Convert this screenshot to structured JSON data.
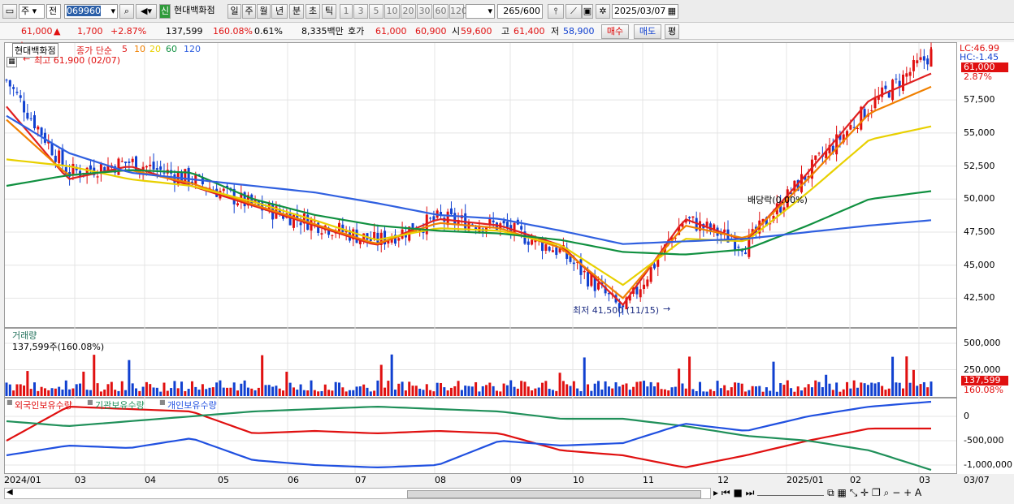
{
  "toolbar": {
    "period_type": "주",
    "prev_label": "전",
    "code": "069960",
    "new_badge": "신",
    "name": "현대백화점",
    "periods": [
      {
        "label": "일",
        "selected": true
      },
      {
        "label": "주",
        "selected": false
      },
      {
        "label": "월",
        "selected": false
      },
      {
        "label": "년",
        "selected": false
      },
      {
        "label": "분",
        "selected": false
      },
      {
        "label": "초",
        "selected": false
      },
      {
        "label": "틱",
        "selected": false
      }
    ],
    "intervals": [
      "1",
      "3",
      "5",
      "10",
      "20",
      "30",
      "60",
      "120"
    ],
    "count": "265",
    "count_total": "/600",
    "date": "2025/03/07"
  },
  "quote": {
    "price": "61,000",
    "change": "1,700",
    "change_pct": "+2.87%",
    "volume": "137,599",
    "volume_ratio": "160.08%",
    "turnover": "0.61%",
    "amount": "8,335백만",
    "ask_label": "호가",
    "ask": "61,000",
    "bid": "60,900",
    "open_label": "시",
    "open": "59,600",
    "high_label": "고",
    "high": "61,400",
    "low_label": "저",
    "low": "58,900",
    "buy_label": "매수",
    "sell_label": "매도",
    "eval_label": "평"
  },
  "price_panel": {
    "title": "현대백화점",
    "ma_label": "종가 단순",
    "ma_periods": [
      {
        "label": "5",
        "color": "#e02020"
      },
      {
        "label": "10",
        "color": "#f08000"
      },
      {
        "label": "20",
        "color": "#e8d000"
      },
      {
        "label": "60",
        "color": "#109040"
      },
      {
        "label": "120",
        "color": "#3060e0"
      }
    ],
    "high_note": "최고 61,900 (02/07)",
    "low_note": "최저 41,500 (11/15)",
    "dividend_note": "배당락(0.00%)",
    "lc": "LC:46.99",
    "hc": "HC:-1.45",
    "last_price": "61,000",
    "last_pct": "2.87%"
  },
  "volume_panel": {
    "title": "거래량",
    "value_note": "137,599주(160.08%)",
    "last_volume": "137,599",
    "last_pct": "160.08%"
  },
  "holder_panel": {
    "legend": [
      {
        "label": "외국인보유수량",
        "color": "#e01010"
      },
      {
        "label": "기관보유수량",
        "color": "#20905a"
      },
      {
        "label": "개인보유수량",
        "color": "#2050e0"
      }
    ]
  },
  "x_labels": [
    "2024/01",
    "03",
    "04",
    "05",
    "06",
    "07",
    "08",
    "09",
    "10",
    "11",
    "12",
    "2025/01",
    "02",
    "03",
    "03/07"
  ],
  "chart_data": [
    {
      "type": "line",
      "title": "현대백화점",
      "x": [
        "2024/01",
        "03",
        "04",
        "05",
        "06",
        "07",
        "08",
        "09",
        "10",
        "11",
        "12",
        "2025/01",
        "02",
        "03"
      ],
      "y_ticks": [
        42500,
        45000,
        47500,
        50000,
        52500,
        55000,
        57500
      ],
      "ylim": [
        40500,
        61500
      ],
      "close": [
        59000,
        52000,
        52800,
        51500,
        49500,
        48200,
        46800,
        48500,
        48000,
        46000,
        41500,
        48500,
        46500,
        52000,
        57000,
        61000
      ],
      "series": [
        {
          "name": "5",
          "values": [
            57000,
            51500,
            52500,
            51000,
            49500,
            48000,
            46500,
            48500,
            48000,
            46500,
            42000,
            48500,
            46800,
            52000,
            57500,
            59500
          ]
        },
        {
          "name": "10",
          "values": [
            56000,
            51800,
            52200,
            51200,
            49600,
            48100,
            46600,
            48200,
            47800,
            46300,
            42500,
            48000,
            47000,
            51500,
            56500,
            58500
          ]
        },
        {
          "name": "20",
          "values": [
            53000,
            52500,
            51500,
            51000,
            49800,
            48400,
            46900,
            47800,
            47600,
            46500,
            43500,
            47000,
            46800,
            50500,
            54500,
            55500
          ]
        },
        {
          "name": "60",
          "values": [
            51000,
            51800,
            52200,
            52000,
            50000,
            48800,
            48000,
            47600,
            47400,
            46900,
            46000,
            45800,
            46200,
            48000,
            50000,
            50600
          ]
        },
        {
          "name": "120",
          "values": [
            56300,
            53500,
            52000,
            51500,
            51000,
            50500,
            49700,
            48800,
            48500,
            47600,
            46600,
            46800,
            47000,
            47500,
            48000,
            48400
          ]
        }
      ],
      "high": 61900,
      "low": 41500,
      "last": 61000
    },
    {
      "type": "bar",
      "title": "거래량",
      "y_ticks": [
        250000,
        500000
      ],
      "ylim": [
        0,
        600000
      ],
      "last": 137599
    },
    {
      "type": "line",
      "y_ticks": [
        0,
        -500000,
        -1000000
      ],
      "ylim": [
        -1150000,
        300000
      ],
      "series": [
        {
          "name": "외국인보유수량",
          "values": [
            -500000,
            200000,
            150000,
            100000,
            -350000,
            -300000,
            -350000,
            -300000,
            -350000,
            -700000,
            -800000,
            -1050000,
            -800000,
            -500000,
            -250000,
            -250000
          ]
        },
        {
          "name": "기관보유수량",
          "values": [
            -100000,
            -200000,
            -100000,
            0,
            100000,
            150000,
            200000,
            150000,
            100000,
            -50000,
            -50000,
            -200000,
            -400000,
            -500000,
            -700000,
            -1100000
          ]
        },
        {
          "name": "개인보유수량",
          "values": [
            -800000,
            -600000,
            -650000,
            -450000,
            -900000,
            -1000000,
            -1050000,
            -1000000,
            -500000,
            -600000,
            -550000,
            -150000,
            -300000,
            0,
            200000,
            300000
          ]
        }
      ]
    }
  ]
}
